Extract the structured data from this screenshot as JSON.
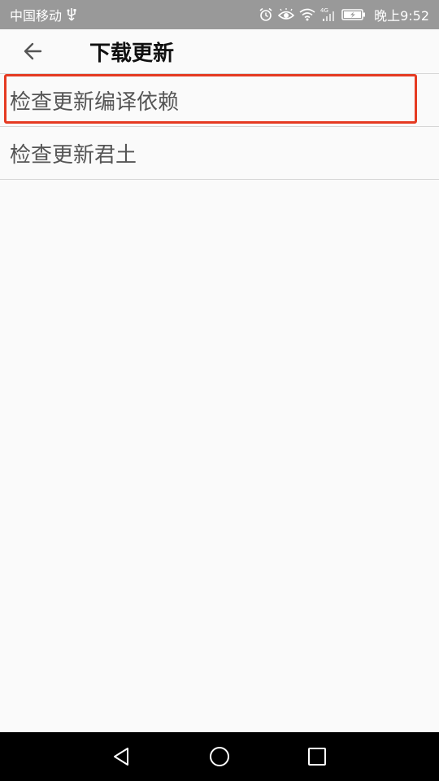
{
  "status_bar": {
    "carrier": "中国移动",
    "network": "4G",
    "time": "晚上9:52"
  },
  "app_bar": {
    "title": "下载更新"
  },
  "list": {
    "items": [
      {
        "label": "检查更新编译依赖",
        "highlighted": true
      },
      {
        "label": "检查更新君土",
        "highlighted": false
      }
    ]
  },
  "colors": {
    "status_bar_bg": "#999999",
    "highlight_border": "#e53a22",
    "background": "#fafafa",
    "nav_bar_bg": "#000000"
  }
}
